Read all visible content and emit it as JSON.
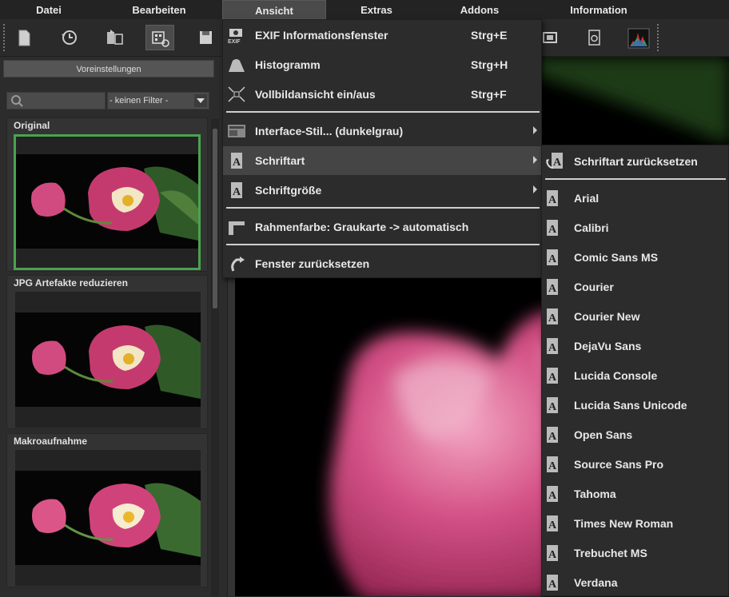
{
  "menubar": {
    "items": [
      "Datei",
      "Bearbeiten",
      "Ansicht",
      "Extras",
      "Addons",
      "Information"
    ],
    "active": "Ansicht"
  },
  "toolbar": {
    "buttons": [
      "new-document-icon",
      "history-icon",
      "compare-icon",
      "presets-icon",
      "save-icon",
      "exif-frame-icon",
      "info-icon",
      "histogram-icon"
    ]
  },
  "left_panel": {
    "presets_button": "Voreinstellungen",
    "search_placeholder": "",
    "filter_value": "- keinen Filter -",
    "presets": [
      {
        "title": "Original"
      },
      {
        "title": "JPG Artefakte reduzieren"
      },
      {
        "title": "Makroaufnahme"
      }
    ]
  },
  "ansicht_menu": {
    "items": [
      {
        "label": "EXIF Informationsfenster",
        "shortcut": "Strg+E",
        "icon": "exif-camera-icon"
      },
      {
        "label": "Histogramm",
        "shortcut": "Strg+H",
        "icon": "histogram-icon"
      },
      {
        "label": "Vollbildansicht ein/aus",
        "shortcut": "Strg+F",
        "icon": "fullscreen-icon"
      },
      {
        "label": "Interface-Stil... (dunkelgrau)",
        "icon": "interface-style-icon",
        "submenu": true
      },
      {
        "label": "Schriftart",
        "icon": "font-icon",
        "submenu": true,
        "highlighted": true
      },
      {
        "label": "Schriftgröße",
        "icon": "font-size-icon",
        "submenu": true
      },
      {
        "label": "Rahmenfarbe: Graukarte -> automatisch",
        "icon": "frame-color-icon"
      },
      {
        "label": "Fenster zurücksetzen",
        "icon": "reset-arrow-icon"
      }
    ]
  },
  "font_menu": {
    "reset_label": "Schriftart zurücksetzen",
    "fonts": [
      "Arial",
      "Calibri",
      "Comic Sans MS",
      "Courier",
      "Courier New",
      "DejaVu Sans",
      "Lucida Console",
      "Lucida Sans Unicode",
      "Open Sans",
      "Source Sans Pro",
      "Tahoma",
      "Times New Roman",
      "Trebuchet MS",
      "Verdana"
    ]
  },
  "colors": {
    "selected_preset_border": "#4aa34f",
    "menu_background": "#2c2c2c",
    "highlight": "#454545"
  }
}
